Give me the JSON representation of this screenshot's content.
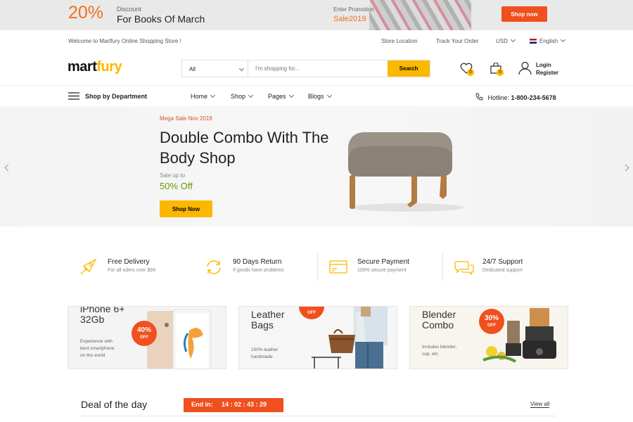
{
  "topbar": {
    "discount_value": "20%",
    "discount_label": "Discount",
    "discount_text": "For Books Of March",
    "promo_label": "Enter Promotion",
    "promo_code": "Sale2019",
    "shop_now": "Shop now",
    "accent": "#f36f21"
  },
  "utility": {
    "welcome": "Welcome to Martfury Online Shopping Store !",
    "store_location": "Store Location",
    "track_order": "Track Your Order",
    "currency": "USD",
    "language": "English"
  },
  "header": {
    "logo_part1": "mart",
    "logo_part2": "fury",
    "search_category": "All",
    "search_placeholder": "I'm shopping for...",
    "search_button": "Search",
    "wishlist_count": "0",
    "cart_count": "0",
    "login": "Login",
    "register": "Register",
    "brand_color": "#fcb800"
  },
  "nav": {
    "department": "Shop by Department",
    "items": [
      "Home",
      "Shop",
      "Pages",
      "Blogs"
    ],
    "hotline_label": "Hotline:",
    "hotline_number": "1-800-234-5678"
  },
  "hero": {
    "tag": "Mega Sale Nov 2019",
    "title": "Double Combo With The Body Shop",
    "sale_label": "Sale up to",
    "sale_value": "50% Off",
    "button": "Shop Now"
  },
  "features": [
    {
      "title": "Free Delivery",
      "subtitle": "For all oders over $99",
      "icon": "rocket-icon"
    },
    {
      "title": "90 Days Return",
      "subtitle": "If goods have problems",
      "icon": "return-icon"
    },
    {
      "title": "Secure Payment",
      "subtitle": "100% secure payment",
      "icon": "credit-card-icon"
    },
    {
      "title": "24/7 Support",
      "subtitle": "Dedicated support",
      "icon": "chat-icon"
    }
  ],
  "promos": [
    {
      "title_l1": "iPhone 6+",
      "title_l2": "32Gb",
      "desc_l1": "Experience with",
      "desc_l2": "best smartphone",
      "desc_l3": "on the world",
      "badge_value": "40%",
      "badge_label": "OFF"
    },
    {
      "title_l1": "Leather",
      "title_l2": "Bags",
      "desc_l1": "100% leather",
      "desc_l2": "handmade",
      "badge_label": "OFF"
    },
    {
      "title_l1": "Blender",
      "title_l2": "Combo",
      "desc_l1": "Includes blender,",
      "desc_l2": "cup, etc",
      "badge_value": "30%",
      "badge_label": "OFF"
    }
  ],
  "deal": {
    "title": "Deal of the day",
    "ends_label": "End in:",
    "countdown": "14 : 02 : 43 : 29",
    "view_all": "View all"
  }
}
